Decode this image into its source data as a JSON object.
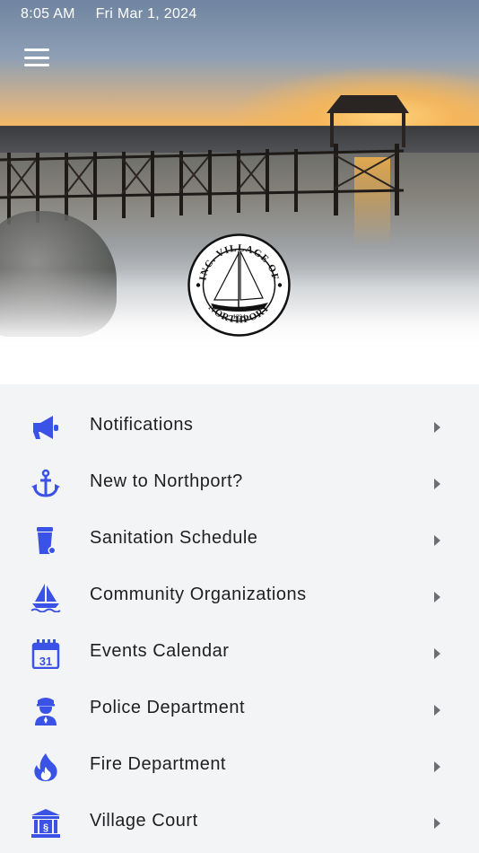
{
  "status_bar": {
    "time": "8:05 AM",
    "date": "Fri Mar 1, 2024"
  },
  "header": {
    "menu_icon": "hamburger-icon",
    "seal": {
      "top_text": "INC. VILLAGE OF",
      "bottom_text": "NORTHPORT",
      "year": "1894"
    }
  },
  "colors": {
    "accent": "#3b52e6",
    "label": "#1f1f22",
    "chevron": "#6d6d72",
    "list_bg": "#f3f4f6"
  },
  "menu": {
    "items": [
      {
        "label": "Notifications",
        "icon": "megaphone-icon"
      },
      {
        "label": "New to Northport?",
        "icon": "anchor-icon"
      },
      {
        "label": "Sanitation Schedule",
        "icon": "trash-bin-icon"
      },
      {
        "label": "Community Organizations",
        "icon": "sailboat-icon"
      },
      {
        "label": "Events Calendar",
        "icon": "calendar-icon"
      },
      {
        "label": "Police Department",
        "icon": "police-officer-icon"
      },
      {
        "label": "Fire Department",
        "icon": "fire-icon"
      },
      {
        "label": "Village Court",
        "icon": "courthouse-icon"
      }
    ]
  }
}
